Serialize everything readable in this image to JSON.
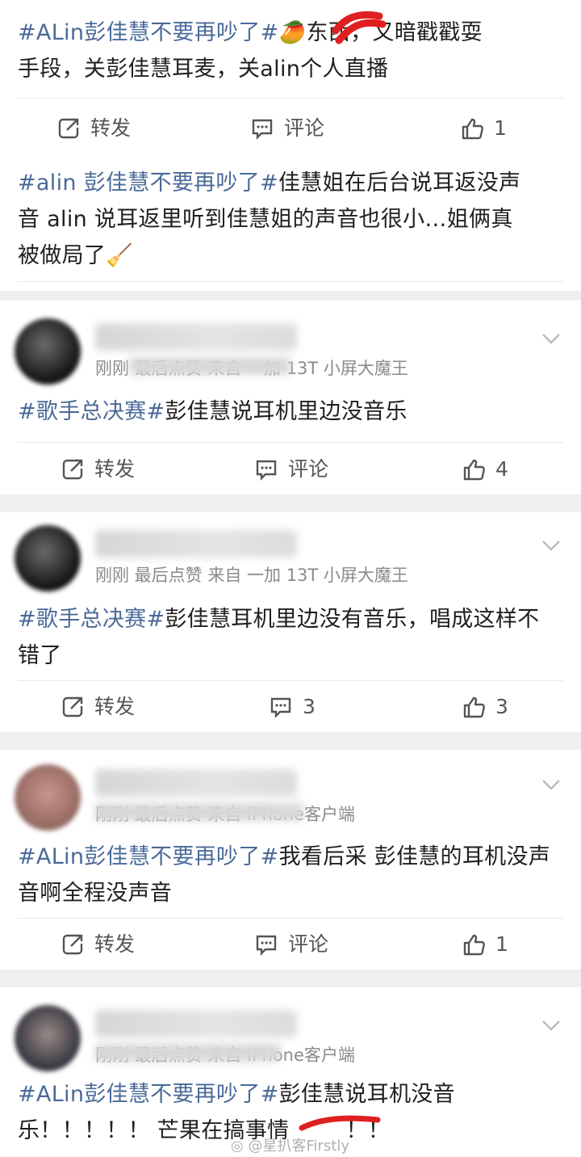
{
  "top_post": {
    "tag": "#ALin彭佳慧不要再吵了#",
    "line1_rest": "东西，又暗戳戳耍",
    "line2": "手段，关彭佳慧耳麦，关alin个人直播",
    "forward_label": "转发",
    "comment_label": "评论",
    "like_count": "1"
  },
  "second_post": {
    "tag": "#alin 彭佳慧不要再吵了#",
    "line1_rest": "佳慧姐在后台说耳返没声",
    "line2": "音 alin 说耳返里听到佳慧姐的声音也很小…姐俩真",
    "line3": "被做局了"
  },
  "comments": [
    {
      "meta": "刚刚  最后点赞  来自  一加 13T 小屏大魔王",
      "tag": "#歌手总决赛#",
      "text_rest": "彭佳慧说耳机里边没音乐",
      "text_line2": "",
      "forward_label": "转发",
      "comment_label": "评论",
      "like_count": "4"
    },
    {
      "meta": "刚刚  最后点赞  来自  一加 13T 小屏大魔王",
      "tag": "#歌手总决赛#",
      "text_rest": "彭佳慧耳机里边没有音乐，唱成这样不",
      "text_line2": "错了",
      "forward_label": "转发",
      "comment_label": "3",
      "like_count": "3"
    },
    {
      "meta": "刚刚  最后点赞  来自  iPhone客户端",
      "tag": "#ALin彭佳慧不要再吵了#",
      "text_rest": "我看后采 彭佳慧的耳机没声",
      "text_line2": "音啊全程没声音",
      "forward_label": "转发",
      "comment_label": "评论",
      "like_count": "1"
    },
    {
      "meta": "刚刚  最后点赞  来自  iPhone客户端",
      "tag": "#ALin彭佳慧不要再吵了#",
      "text_rest": "彭佳慧说耳机没音",
      "text_line2": "乐！！！！！ 芒果在搞事情",
      "text_line2_end": "！！",
      "forward_label": "",
      "comment_label": "",
      "like_count": ""
    }
  ],
  "watermark": "@星扒客Firstly",
  "colors": {
    "tag": "#4a6a98",
    "separator": "#efefef",
    "meta": "#8a8a8a"
  }
}
